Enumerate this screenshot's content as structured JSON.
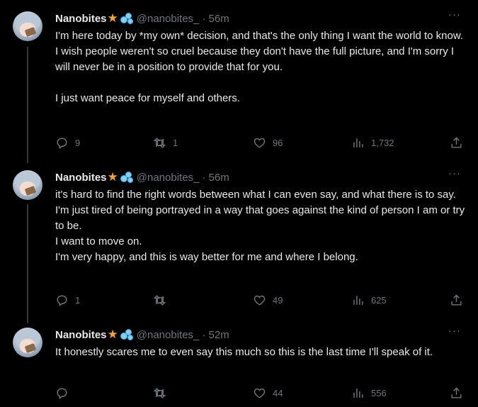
{
  "colors": {
    "background": "#000000",
    "text": "#e7e9ea",
    "muted": "#71767b",
    "star": "#f6a623"
  },
  "tweets": [
    {
      "name": "Nanobites",
      "handle": "@nanobites_",
      "time": "· 56m",
      "more": "···",
      "text": "I'm here today by *my own* decision, and that's the only thing I want the world to know.\nI wish people weren't so cruel because they don't have the full picture, and I'm sorry I will never be in a position to provide that for you.\n\nI just want peace for myself and others.",
      "replies": "9",
      "retweets": "1",
      "likes": "96",
      "views": "1,732"
    },
    {
      "name": "Nanobites",
      "handle": "@nanobites_",
      "time": "· 56m",
      "more": "···",
      "text": "it's hard to find the right words between what I can even say, and what there is to say.\nI'm just tired of being portrayed in a way that goes against the kind of person I am or try to be.\nI want to move on.\nI'm very happy, and this is way better for me and where I belong.",
      "replies": "1",
      "retweets": "",
      "likes": "49",
      "views": "625"
    },
    {
      "name": "Nanobites",
      "handle": "@nanobites_",
      "time": "· 52m",
      "more": "···",
      "text": "It honestly scares me to even say this much so this is the last time I'll speak of it.",
      "replies": "",
      "retweets": "",
      "likes": "44",
      "views": "556"
    }
  ]
}
